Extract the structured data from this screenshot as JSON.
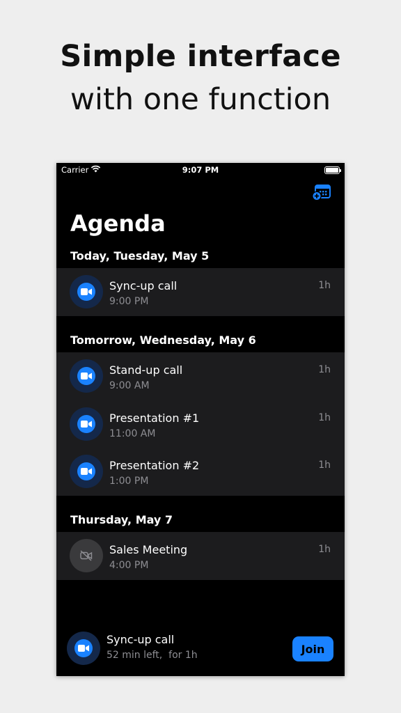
{
  "promo": {
    "title": "Simple interface",
    "subtitle": "with one function"
  },
  "status_bar": {
    "carrier": "Carrier",
    "time": "9:07 PM",
    "icons": [
      "wifi-icon",
      "battery-icon"
    ]
  },
  "header": {
    "title": "Agenda",
    "add_calendar_icon": "calendar-plus-icon"
  },
  "colors": {
    "background": "#000000",
    "row_background": "#1c1c1e",
    "accent": "#1a82ff",
    "secondary_text": "#8e8e93",
    "page_background": "#eeeeee"
  },
  "sections": [
    {
      "header": "Today, Tuesday, May 5",
      "events": [
        {
          "name": "Sync-up call",
          "time": "9:00 PM",
          "duration": "1h",
          "icon": "video-icon"
        }
      ]
    },
    {
      "header": "Tomorrow, Wednesday, May 6",
      "events": [
        {
          "name": "Stand-up call",
          "time": "9:00 AM",
          "duration": "1h",
          "icon": "video-icon"
        },
        {
          "name": "Presentation #1",
          "time": "11:00 AM",
          "duration": "1h",
          "icon": "video-icon"
        },
        {
          "name": "Presentation #2",
          "time": "1:00 PM",
          "duration": "1h",
          "icon": "video-icon"
        }
      ]
    },
    {
      "header": "Thursday, May 7",
      "events": [
        {
          "name": "Sales Meeting",
          "time": "4:00 PM",
          "duration": "1h",
          "icon": "video-off-icon"
        }
      ]
    }
  ],
  "now_playing": {
    "name": "Sync-up call",
    "subtitle": "52 min left,  for 1h",
    "join_label": "Join",
    "icon": "video-icon"
  }
}
